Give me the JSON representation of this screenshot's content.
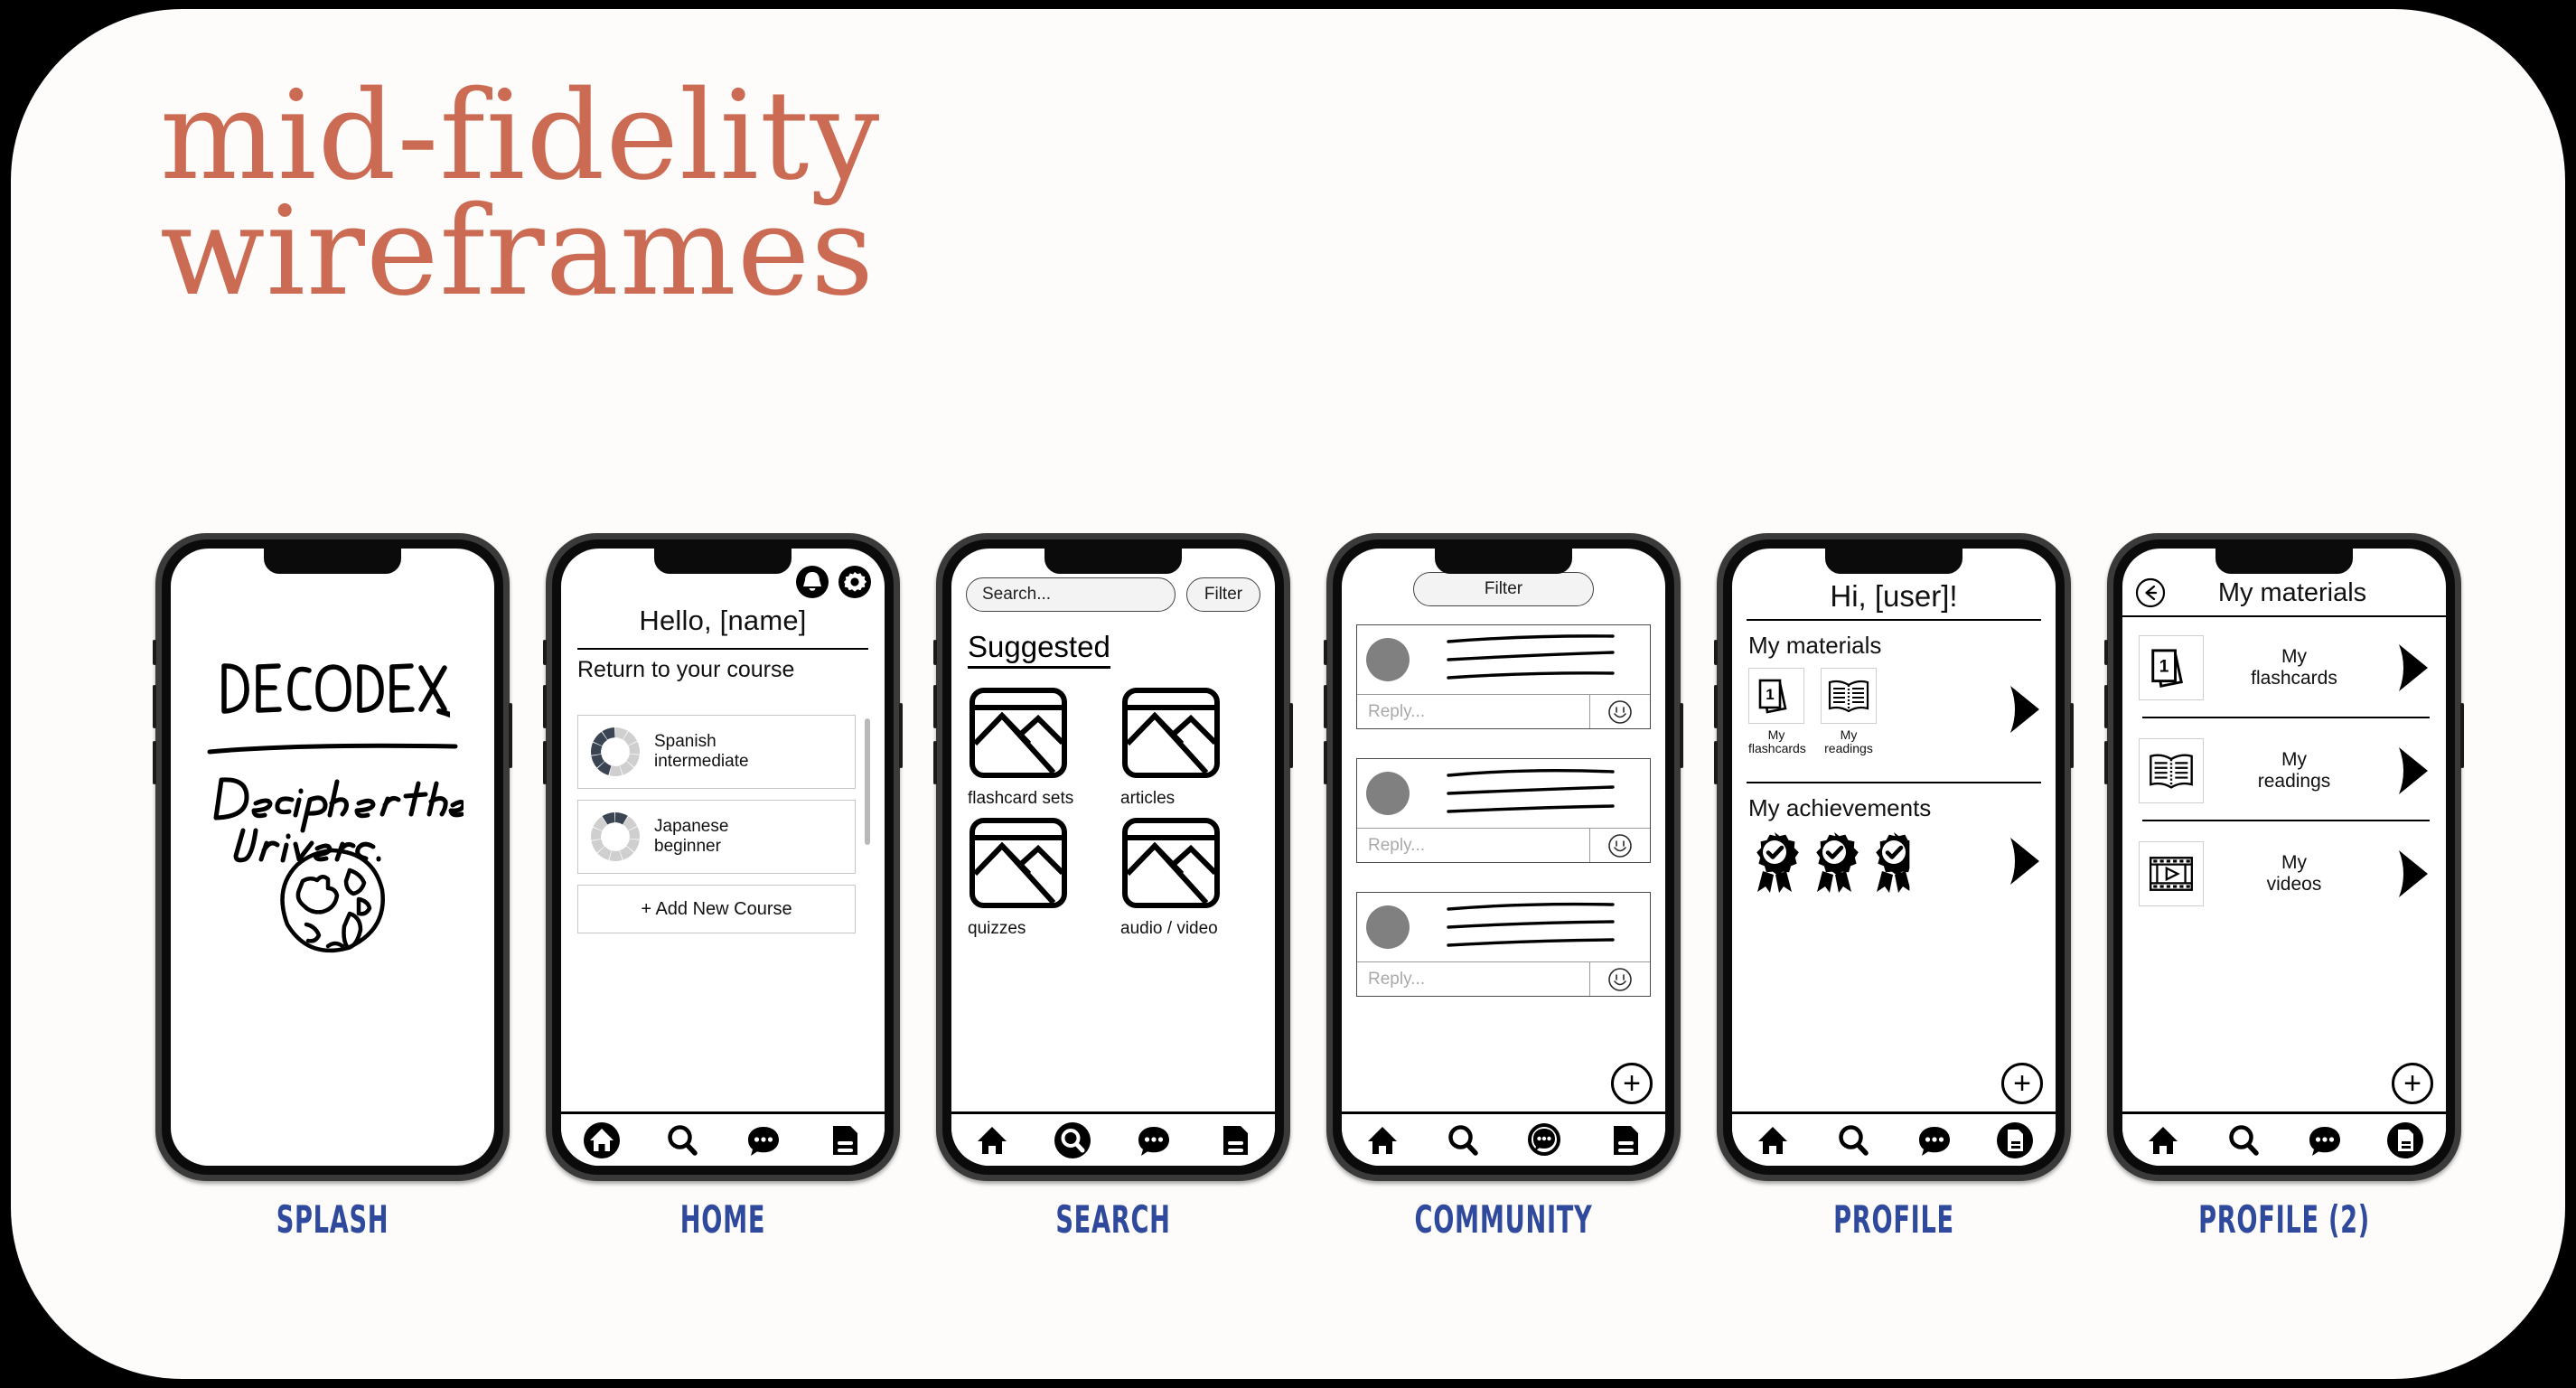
{
  "title": {
    "line1": "mid-fidelity",
    "line2": "wireframes",
    "color": "#cc6b53"
  },
  "label_color": "#2f4a9c",
  "screens": [
    {
      "key": "splash",
      "label": "SPLASH",
      "logo": "DECODEX",
      "tagline_line1": "Decipher the",
      "tagline_line2": "Universe.",
      "globe_icon": "globe-sketch-icon"
    },
    {
      "key": "home",
      "label": "HOME",
      "bell_icon": "bell-icon",
      "gear_icon": "gear-icon",
      "greeting": "Hello, [name]",
      "section_title": "Return to your course",
      "courses": [
        {
          "name_line1": "Spanish",
          "name_line2": "intermediate",
          "progress_segments": 5,
          "total_segments": 11
        },
        {
          "name_line1": "Japanese",
          "name_line2": "beginner",
          "progress_segments": 2,
          "total_segments": 11
        }
      ],
      "add_course": "+ Add New Course",
      "nav_active": "home"
    },
    {
      "key": "search",
      "label": "SEARCH",
      "search_placeholder": "Search...",
      "filter_label": "Filter",
      "suggested_heading": "Suggested",
      "tiles": [
        {
          "caption": "flashcard sets",
          "icon": "image-placeholder-icon"
        },
        {
          "caption": "articles",
          "icon": "image-placeholder-icon"
        },
        {
          "caption": "quizzes",
          "icon": "image-placeholder-icon"
        },
        {
          "caption": "audio / video",
          "icon": "image-placeholder-icon"
        }
      ],
      "nav_active": "search"
    },
    {
      "key": "community",
      "label": "COMMUNITY",
      "filter_label": "Filter",
      "posts": [
        {
          "reply_placeholder": "Reply...",
          "emoji_icon": "smiley-icon"
        },
        {
          "reply_placeholder": "Reply...",
          "emoji_icon": "smiley-icon"
        },
        {
          "reply_placeholder": "Reply...",
          "emoji_icon": "smiley-icon"
        }
      ],
      "fab_label": "+",
      "nav_active": "community"
    },
    {
      "key": "profile",
      "label": "PROFILE",
      "greeting": "Hi, [user]!",
      "materials_title": "My materials",
      "materials": [
        {
          "caption_line1": "My",
          "caption_line2": "flashcards",
          "icon": "flashcards-icon",
          "badge": "1"
        },
        {
          "caption_line1": "My",
          "caption_line2": "readings",
          "icon": "open-book-icon"
        }
      ],
      "achievements_title": "My achievements",
      "achievement_count": 3,
      "achievement_icon": "award-ribbon-icon",
      "fab_label": "+",
      "nav_active": "profile"
    },
    {
      "key": "profile2",
      "label": "PROFILE (2)",
      "back_icon": "back-arrow-icon",
      "header": "My materials",
      "rows": [
        {
          "label_line1": "My",
          "label_line2": "flashcards",
          "icon": "flashcards-icon",
          "badge": "1"
        },
        {
          "label_line1": "My",
          "label_line2": "readings",
          "icon": "open-book-icon"
        },
        {
          "label_line1": "My",
          "label_line2": "videos",
          "icon": "film-strip-icon"
        }
      ],
      "fab_label": "+",
      "nav_active": "profile"
    }
  ],
  "nav": {
    "home_icon": "home-icon",
    "search_icon": "search-icon",
    "community_icon": "chat-bubble-icon",
    "profile_icon": "document-icon"
  }
}
